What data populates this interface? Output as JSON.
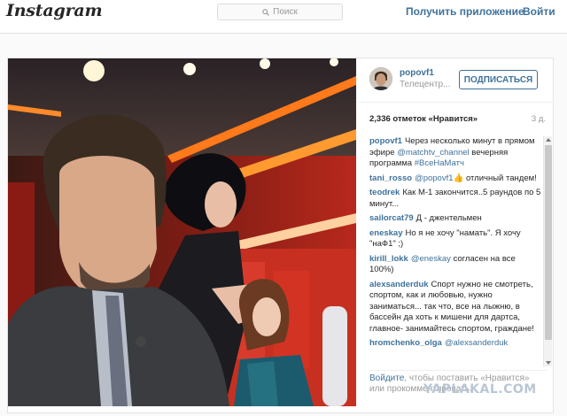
{
  "header": {
    "logo": "Instagram",
    "search_placeholder": "Поиск",
    "get_app": "Получить приложение",
    "login": "Войти"
  },
  "post": {
    "username": "popovf1",
    "subtitle": "Телецентр...",
    "follow_label": "ПОДПИСАТЬСЯ",
    "likes": "2,336 отметок «Нравится»",
    "age": "3 д.",
    "comments": [
      {
        "user": "popovf1",
        "pre": "Через несколько минут в прямом эфире ",
        "link": "@matchtv_channel",
        "post": " вечерняя программа ",
        "tag": "#ВсеНаМатч"
      },
      {
        "user": "tani_rosso",
        "pre": "",
        "link": "@popovf1",
        "post": "👍 отличный тандем!",
        "tag": ""
      },
      {
        "user": "teodrek",
        "pre": "Как М-1 закончится..5 раундов по 5 минут...",
        "link": "",
        "post": "",
        "tag": ""
      },
      {
        "user": "sailorcat79",
        "pre": "Д - джентельмен",
        "link": "",
        "post": "",
        "tag": ""
      },
      {
        "user": "eneskay",
        "pre": "Но я не хочу \"намать\". Я хочу \"наФ1\" ;)",
        "link": "",
        "post": "",
        "tag": ""
      },
      {
        "user": "kirill_lokk",
        "pre": "",
        "link": "@eneskay",
        "post": " согласен на все 100%)",
        "tag": ""
      },
      {
        "user": "alexsanderduk",
        "pre": "Спорт нужно не смотреть, спортом, как и любовью, нужно заниматься... так что, все на лыжню, в бассейн да хоть к мишени для дартса, главное- занимайтесь спортом, граждане!",
        "link": "",
        "post": "",
        "tag": ""
      },
      {
        "user": "hromchenko_olga",
        "pre": "",
        "link": "@alexsanderduk",
        "post": "",
        "tag": ""
      }
    ],
    "prompt_login": "Войдите",
    "prompt_rest": ", чтобы поставить «Нравится» или прокомментировать."
  },
  "watermark": "YAPLAKAL.COM",
  "colors": {
    "link_blue": "#3f729b",
    "muted": "#999999",
    "border": "#e3e3e3"
  }
}
